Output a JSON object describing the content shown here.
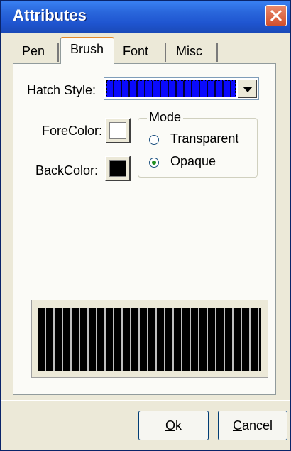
{
  "window": {
    "title": "Attributes"
  },
  "tabs": [
    {
      "label": "Pen"
    },
    {
      "label": "Brush"
    },
    {
      "label": "Font"
    },
    {
      "label": "Misc"
    }
  ],
  "brush": {
    "hatch_label": "Hatch Style:",
    "forecolor_label": "ForeColor:",
    "backcolor_label": "BackColor:",
    "forecolor": "#ffffff",
    "backcolor": "#000000",
    "hatch_selected_color": "#0a0aff"
  },
  "mode": {
    "title": "Mode",
    "options": [
      {
        "label": "Transparent",
        "selected": false
      },
      {
        "label": "Opaque",
        "selected": true
      }
    ]
  },
  "buttons": {
    "ok": {
      "mnemonic": "O",
      "rest": "k"
    },
    "cancel": {
      "mnemonic": "C",
      "rest": "ancel"
    }
  }
}
